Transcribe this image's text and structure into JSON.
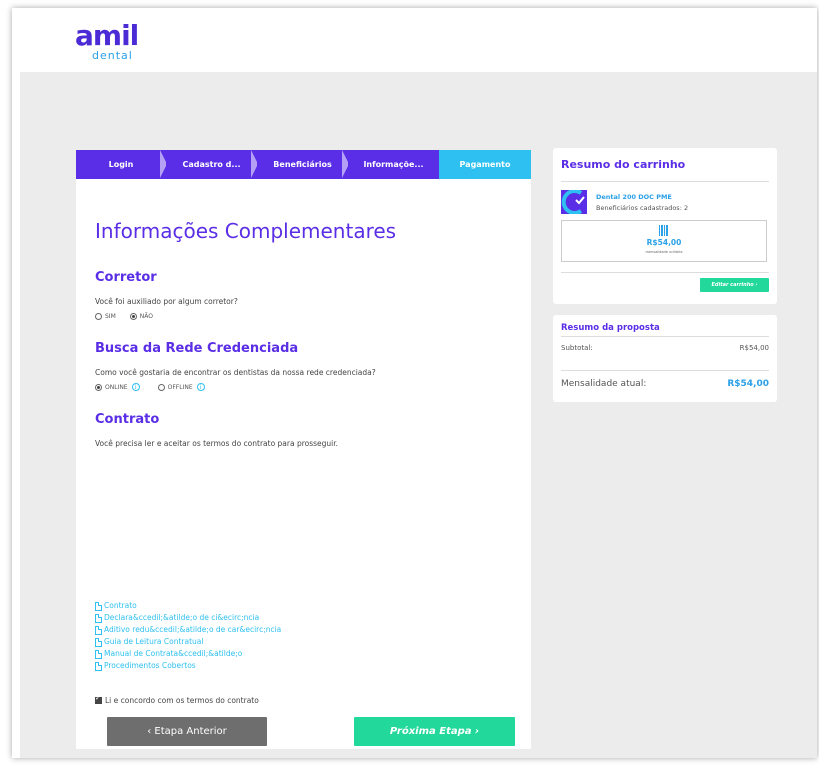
{
  "brand": {
    "name": "amil",
    "sub": "dental",
    "primary_color": "#5a2ee6",
    "accent_color": "#2ec0f0",
    "success_color": "#22d89a"
  },
  "steps": [
    {
      "label": "Login",
      "active": false
    },
    {
      "label": "Cadastro d...",
      "active": false
    },
    {
      "label": "Beneficiários",
      "active": false
    },
    {
      "label": "Informaçõe...",
      "active": false
    },
    {
      "label": "Pagamento",
      "active": true
    }
  ],
  "main": {
    "title": "Informações Complementares",
    "corretor": {
      "title": "Corretor",
      "question": "Você foi auxiliado por algum corretor?",
      "options": [
        {
          "label": "SIM",
          "checked": false
        },
        {
          "label": "NÃO",
          "checked": true
        }
      ]
    },
    "rede": {
      "title": "Busca da Rede Credenciada",
      "question": "Como você gostaria de encontrar os dentistas da nossa rede credenciada?",
      "options": [
        {
          "label": "ONLINE",
          "checked": true
        },
        {
          "label": "OFFLINE",
          "checked": false
        }
      ],
      "info_icon": "i"
    },
    "contrato": {
      "title": "Contrato",
      "text": "Você precisa ler e aceitar os termos do contrato para prosseguir."
    },
    "doc_links": [
      "Contrato",
      "Declara&ccedil;&atilde;o de ci&ecirc;ncia",
      "Aditivo redu&ccedil;&atilde;o de car&ecirc;ncia",
      "Guia de Leitura Contratual",
      "Manual de Contrata&ccedil;&atilde;o",
      "Procedimentos Cobertos"
    ],
    "agree_label": "Li e concordo com os termos do contrato",
    "agree_checked": true,
    "prev_button": "‹   Etapa Anterior",
    "next_button": "Próxima Etapa   ›"
  },
  "cart": {
    "title": "Resumo do carrinho",
    "product_name": "Dental 200 DOC PME",
    "beneficiaries": "Beneficiários cadastrados: 2",
    "price": "R$54,00",
    "price_note": "mensalidade unitária",
    "edit_button": "Editar carrinho ›"
  },
  "proposal": {
    "title": "Resumo da proposta",
    "subtotal_label": "Subtotal:",
    "subtotal_value": "R$54,00",
    "monthly_label": "Mensalidade atual:",
    "monthly_value": "R$54,00"
  }
}
